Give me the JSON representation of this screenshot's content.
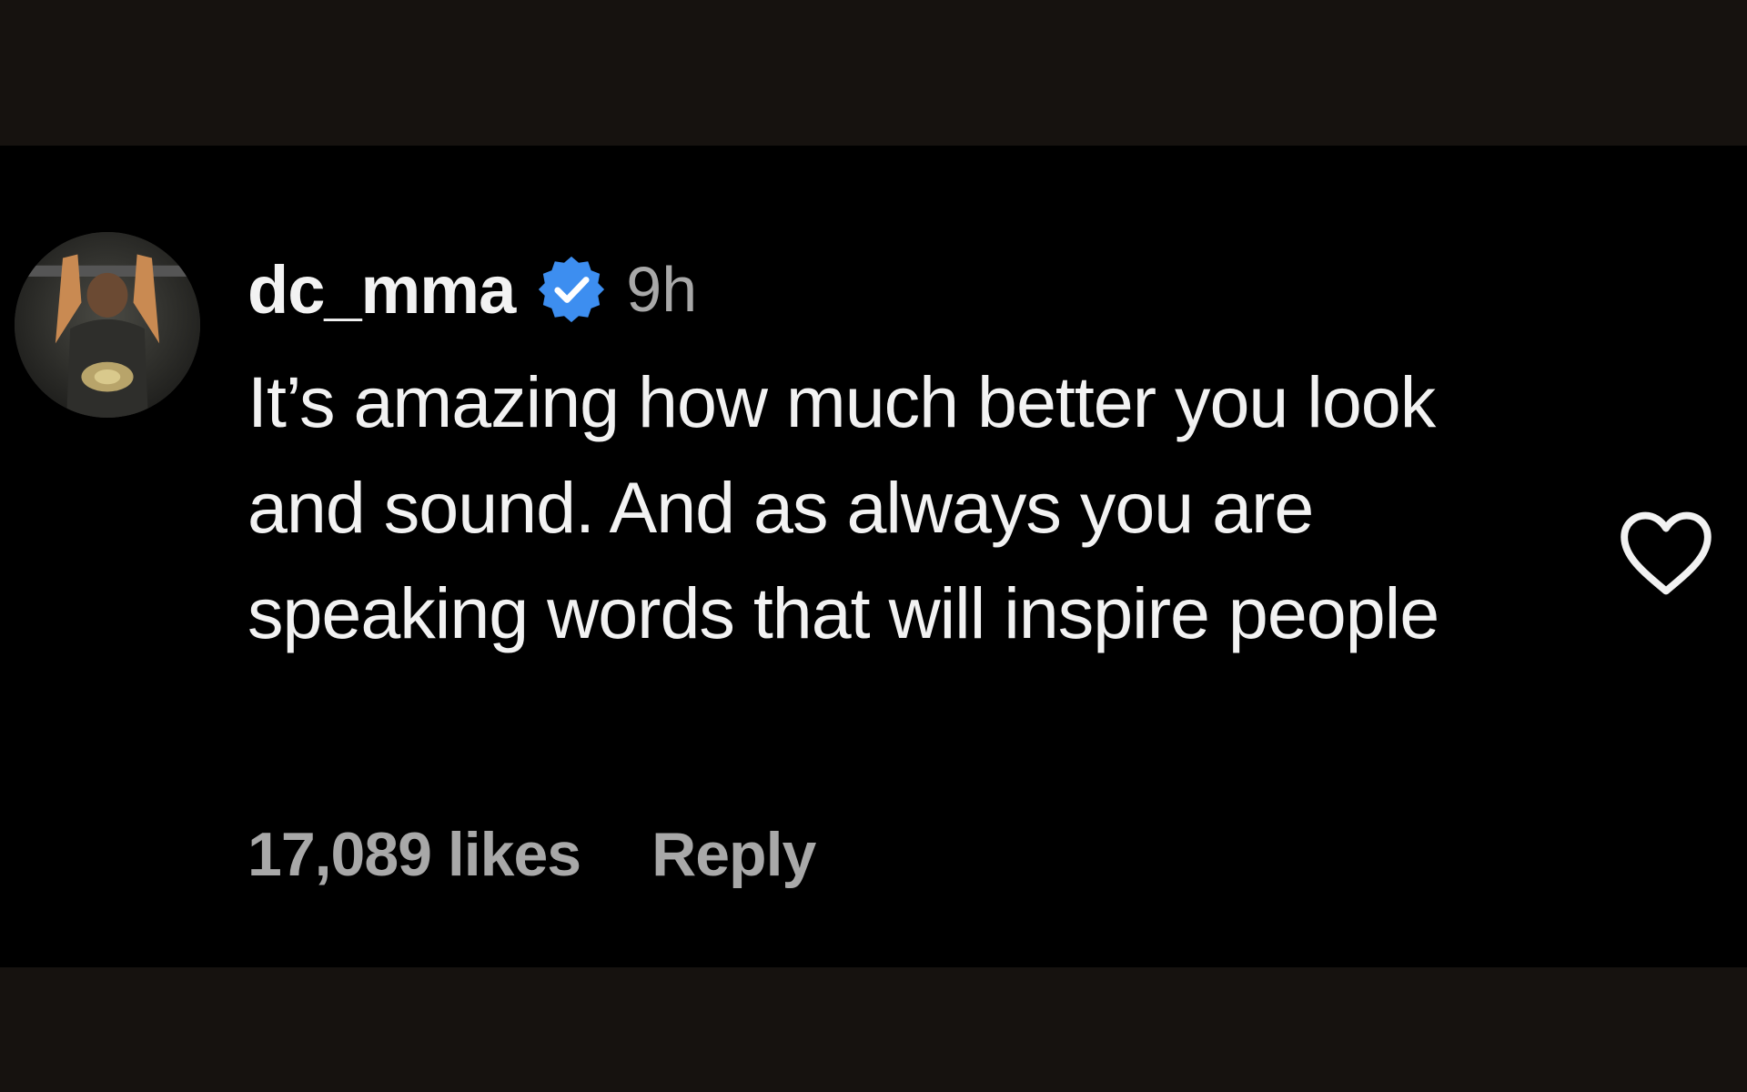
{
  "comment": {
    "username": "dc_mma",
    "verified": true,
    "timestamp": "9h",
    "text": "It’s amazing how much better you look and sound. And as always you are speaking words that will inspire people",
    "likes": "17,089 likes",
    "reply_label": "Reply",
    "avatar_icon": "profile-photo",
    "like_icon": "heart-outline-icon"
  },
  "colors": {
    "page_background": "#16120f",
    "panel_background": "#000000",
    "primary_text": "#f2f2f2",
    "secondary_text": "#a8a8a8",
    "verified_badge": "#3d8ef0"
  }
}
